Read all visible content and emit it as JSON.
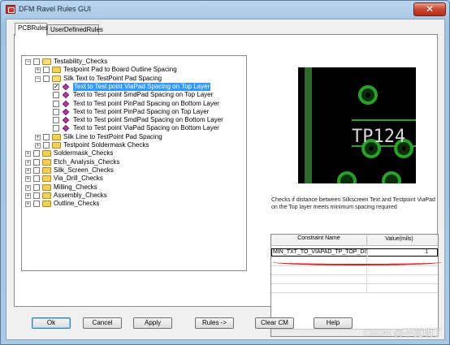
{
  "window": {
    "title": "DFM Ravel Rules GUI",
    "close_label": "✕"
  },
  "tabs": [
    {
      "label": "PCBRules"
    },
    {
      "label": "UserDefinedRules"
    }
  ],
  "tree": [
    {
      "label": "Testability_Checks",
      "level": 0,
      "expander": "−",
      "checkbox": "",
      "icon": "folder-open"
    },
    {
      "label": "Testpoint Pad to Board Outline Spacing",
      "level": 1,
      "expander": "+",
      "checkbox": "",
      "icon": "folder"
    },
    {
      "label": "Silk Text to TestPoint Pad Spacing",
      "level": 1,
      "expander": "−",
      "checkbox": "",
      "icon": "folder-open"
    },
    {
      "label": "Text to Test point ViaPad Spacing on Top Layer",
      "level": 2,
      "expander": "",
      "checkbox": "✓",
      "icon": "diamond",
      "selected": true
    },
    {
      "label": "Text to Test point SmdPad Spacing on Top Layer",
      "level": 2,
      "expander": "",
      "checkbox": "",
      "icon": "diamond"
    },
    {
      "label": "Text to Test point PinPad Spacing on Bottom Layer",
      "level": 2,
      "expander": "",
      "checkbox": "",
      "icon": "diamond"
    },
    {
      "label": "Text to Test point PinPad Spacing on Top Layer",
      "level": 2,
      "expander": "",
      "checkbox": "",
      "icon": "diamond"
    },
    {
      "label": "Text to Test point SmdPad Spacing on Bottom Layer",
      "level": 2,
      "expander": "",
      "checkbox": "",
      "icon": "diamond"
    },
    {
      "label": "Text to Test point ViaPad Spacing on Bottom Layer",
      "level": 2,
      "expander": "",
      "checkbox": "",
      "icon": "diamond"
    },
    {
      "label": "Silk Line to TestPoint Pad Spacing",
      "level": 1,
      "expander": "+",
      "checkbox": "",
      "icon": "folder"
    },
    {
      "label": "Testpoint Soldermask Checks",
      "level": 1,
      "expander": "+",
      "checkbox": "",
      "icon": "folder"
    },
    {
      "label": "Soldermask_Checks",
      "level": 0,
      "expander": "+",
      "checkbox": "",
      "icon": "folder"
    },
    {
      "label": "Etch_Analysis_Checks",
      "level": 0,
      "expander": "+",
      "checkbox": "",
      "icon": "folder"
    },
    {
      "label": "Silk_Screen_Checks",
      "level": 0,
      "expander": "+",
      "checkbox": "",
      "icon": "folder"
    },
    {
      "label": "Via_Drill_Checks",
      "level": 0,
      "expander": "+",
      "checkbox": "",
      "icon": "folder"
    },
    {
      "label": "Milling_Checks",
      "level": 0,
      "expander": "+",
      "checkbox": "",
      "icon": "folder"
    },
    {
      "label": "Assembly_Checks",
      "level": 0,
      "expander": "+",
      "checkbox": "",
      "icon": "folder"
    },
    {
      "label": "Outline_Checks",
      "level": 0,
      "expander": "+",
      "checkbox": "",
      "icon": "folder"
    }
  ],
  "preview": {
    "text": "TP124"
  },
  "description": "Checks if distance between Silkscreen Text and Testpoint ViaPad on the Top layer meets minimum spacing required",
  "grid": {
    "headers": [
      "Constraint Name",
      "Value(mils)"
    ],
    "rows": [
      {
        "name": "MIN_TXT_TO_VIAPAD_TP_TOP_DIS",
        "value": "1"
      }
    ]
  },
  "buttons": {
    "ok": "Ok",
    "cancel": "Cancel",
    "apply": "Apply",
    "rules": "Rules ->",
    "clear": "Clear CM",
    "help": "Help"
  },
  "watermark": "CSDN @不觉明了"
}
